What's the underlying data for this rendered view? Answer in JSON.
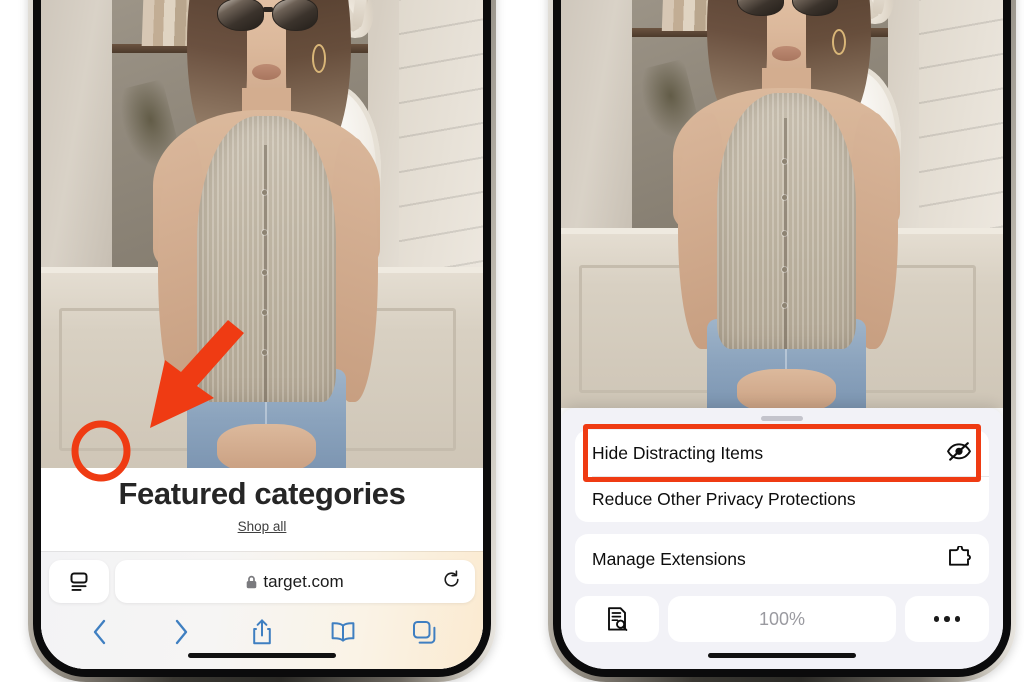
{
  "meta": {
    "description": "Two iPhone screenshots side by side showing Safari on target.com; left shows the page-settings button circled with a red arrow, right shows the Safari page-settings menu with Hide Distracting Items highlighted in red.",
    "background_color": "#ffffff",
    "annotation_color": "#ef3b13"
  },
  "left_phone": {
    "webpage": {
      "heading": "Featured categories",
      "link": "Shop all"
    },
    "safari": {
      "page_settings_icon": "page-settings-aa-icon",
      "lock_icon": "lock-icon",
      "url": "target.com",
      "reload_icon": "reload-icon",
      "toolbar": [
        {
          "name": "back-button",
          "icon": "chevron-left-icon"
        },
        {
          "name": "forward-button",
          "icon": "chevron-right-icon"
        },
        {
          "name": "share-button",
          "icon": "share-icon"
        },
        {
          "name": "bookmarks-button",
          "icon": "book-icon"
        },
        {
          "name": "tabs-button",
          "icon": "tabs-icon"
        }
      ]
    },
    "annotation": {
      "circle_target": "page-settings-button",
      "arrow": "red-arrow-pointing-to-page-settings-button"
    }
  },
  "right_phone": {
    "sheet": {
      "grabber": "sheet-grabber",
      "groups": [
        {
          "name": "privacy-group",
          "rows": [
            {
              "label": "Hide Distracting Items",
              "icon": "eye-slash-icon",
              "highlighted": true
            },
            {
              "label": "Reduce Other Privacy Protections",
              "icon": "",
              "highlighted": false
            }
          ]
        },
        {
          "name": "extensions-group",
          "rows": [
            {
              "label": "Manage Extensions",
              "icon": "puzzle-piece-icon",
              "highlighted": false
            }
          ]
        }
      ],
      "bottom_row": [
        {
          "name": "find-on-page-button",
          "icon": "document-search-icon",
          "label": ""
        },
        {
          "name": "page-zoom-value",
          "icon": "",
          "label": "100%"
        },
        {
          "name": "more-options-button",
          "icon": "ellipsis-icon",
          "label": ""
        }
      ]
    }
  }
}
